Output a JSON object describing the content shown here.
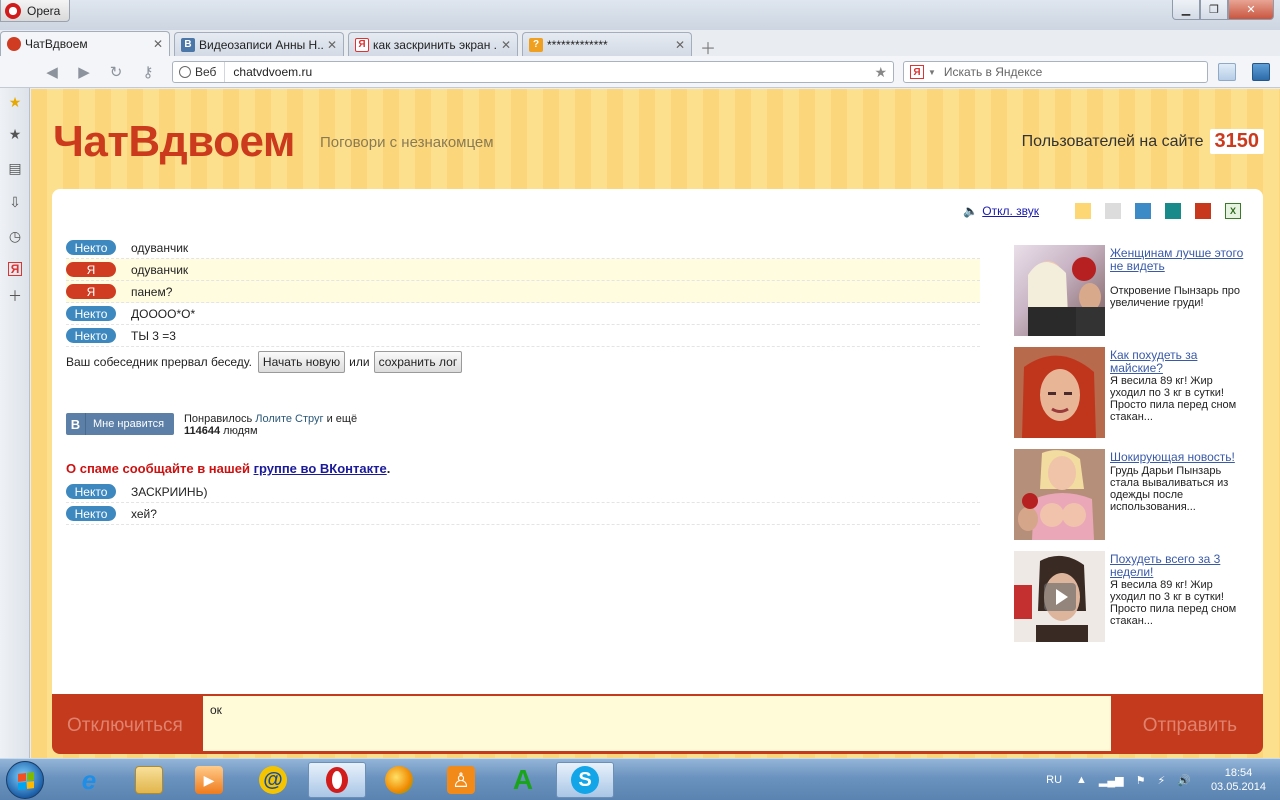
{
  "browser": {
    "menu_label": "Opera",
    "tabs": [
      {
        "label": "ЧатВдвоем",
        "favicon": "chat-bubble-icon"
      },
      {
        "label": "Видеозаписи Анны Н...",
        "favicon": "vk-icon"
      },
      {
        "label": "как заскринить экран ...",
        "favicon": "yandex-icon"
      },
      {
        "label": "*************",
        "favicon": "question-icon"
      }
    ],
    "address": {
      "mode_label": "Веб",
      "url": "chatvdvoem.ru"
    },
    "search": {
      "engine_label": "Я",
      "placeholder": "Искать в Яндексе"
    }
  },
  "site": {
    "logo": "ЧатВдвоем",
    "tagline": "Поговори с незнакомцем",
    "users_label": "Пользователей на сайте",
    "users_count": "3150",
    "mute_label": "Откл. звук",
    "theme_colors": [
      "#fcd773",
      "#dcdcdc",
      "#3c8bc6",
      "#178a89",
      "#c7381d"
    ]
  },
  "chat": {
    "messages": [
      {
        "who": "Некто",
        "role": "stranger",
        "text": "одуванчик"
      },
      {
        "who": "Я",
        "role": "self",
        "text": "одуванчик"
      },
      {
        "who": "Я",
        "role": "self",
        "text": "панем?"
      },
      {
        "who": "Некто",
        "role": "stranger",
        "text": "ДОООО*О*"
      },
      {
        "who": "Некто",
        "role": "stranger",
        "text": "ТЫ 3 =3"
      }
    ],
    "ended_text": "Ваш собеседник прервал беседу.",
    "new_chat_button": "Начать новую",
    "or_text": "или",
    "save_log_button": "сохранить лог",
    "vk_like": {
      "button_letter": "В",
      "button_label": "Мне нравится",
      "liked_prefix": "Понравилось",
      "liked_name": "Лолите Струг",
      "liked_suffix": "и ещё",
      "count": "114644",
      "count_suffix": "людям"
    },
    "spam_text": "О спаме сообщайте в нашей",
    "spam_link": "группе во ВКонтакте",
    "spam_end": ".",
    "messages2": [
      {
        "who": "Некто",
        "role": "stranger",
        "text": "ЗАСКРИИНЬ)"
      },
      {
        "who": "Некто",
        "role": "stranger",
        "text": "хей?"
      }
    ]
  },
  "ads": [
    {
      "title": "Женщинам лучше этого не видеть",
      "desc": "Откровение Пынзарь про увеличение груди!"
    },
    {
      "title": "Как похудеть за майские?",
      "desc": "Я весила 89 кг! Жир уходил по 3 кг в сутки! Просто пила перед сном стакан..."
    },
    {
      "title": "Шокирующая новость!",
      "desc": "Грудь Дарьи Пынзарь стала вываливаться из одежды после использования..."
    },
    {
      "title": "Похудеть всего за 3 недели!",
      "desc": "Я весила 89 кг! Жир уходил по 3 кг в сутки! Просто пила перед сном стакан..."
    }
  ],
  "input": {
    "disconnect_label": "Отключиться",
    "send_label": "Отправить",
    "value": "ок"
  },
  "taskbar": {
    "lang": "RU",
    "time": "18:54",
    "date": "03.05.2014"
  }
}
